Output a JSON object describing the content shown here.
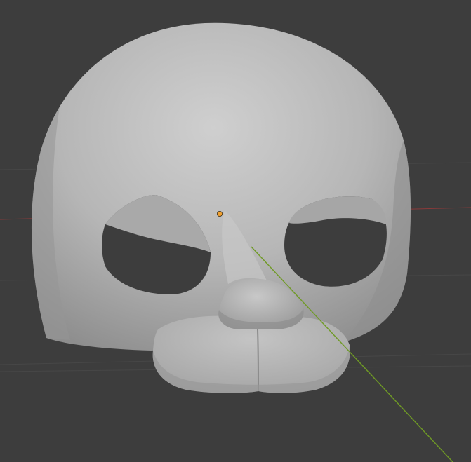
{
  "viewport": {
    "background_color": "#3d3d3d",
    "grid_line_color": "#474747",
    "x_axis_color": "#8a3a3a",
    "y_axis_color": "#6f9a25",
    "model_color": "#b5b5b5",
    "origin_color": "#f0a030",
    "object": "mask",
    "origin_icon": "object-origin-dot"
  }
}
